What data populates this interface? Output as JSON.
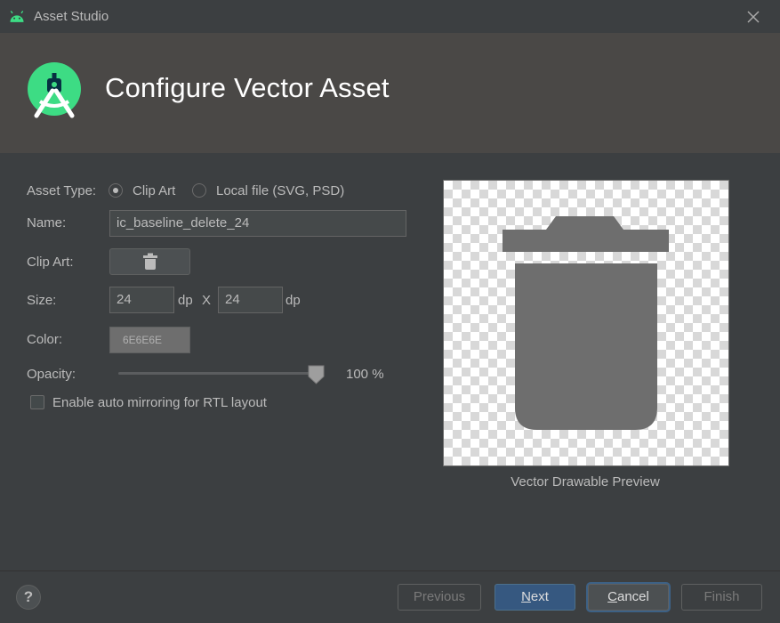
{
  "window": {
    "title": "Asset Studio",
    "close_icon": "close-icon",
    "app_icon": "android-icon"
  },
  "header": {
    "title": "Configure Vector Asset",
    "logo_icon": "android-studio-logo"
  },
  "form": {
    "asset_type_label": "Asset Type:",
    "asset_type_options": [
      {
        "label": "Clip Art",
        "selected": true
      },
      {
        "label": "Local file (SVG, PSD)",
        "selected": false
      }
    ],
    "name_label": "Name:",
    "name_value": "ic_baseline_delete_24",
    "clip_art_label": "Clip Art:",
    "clip_art_icon": "delete-icon",
    "size_label": "Size:",
    "width_value": "24",
    "height_value": "24",
    "unit": "dp",
    "size_separator": "X",
    "color_label": "Color:",
    "color_value": "6E6E6E",
    "opacity_label": "Opacity:",
    "opacity_value": 100,
    "opacity_text": "100 %",
    "auto_mirror_label": "Enable auto mirroring for RTL layout",
    "auto_mirror_checked": false
  },
  "preview": {
    "caption": "Vector Drawable Preview",
    "icon_color": "#6E6E6E"
  },
  "footer": {
    "help": "?",
    "previous": "Previous",
    "next_mnemonic": "N",
    "next_rest": "ext",
    "cancel_mnemonic": "C",
    "cancel_rest": "ancel",
    "finish": "Finish"
  },
  "colors": {
    "background": "#3c3f41",
    "header": "#4a4846",
    "primary_button": "#365880",
    "android_green": "#3ddc84"
  }
}
